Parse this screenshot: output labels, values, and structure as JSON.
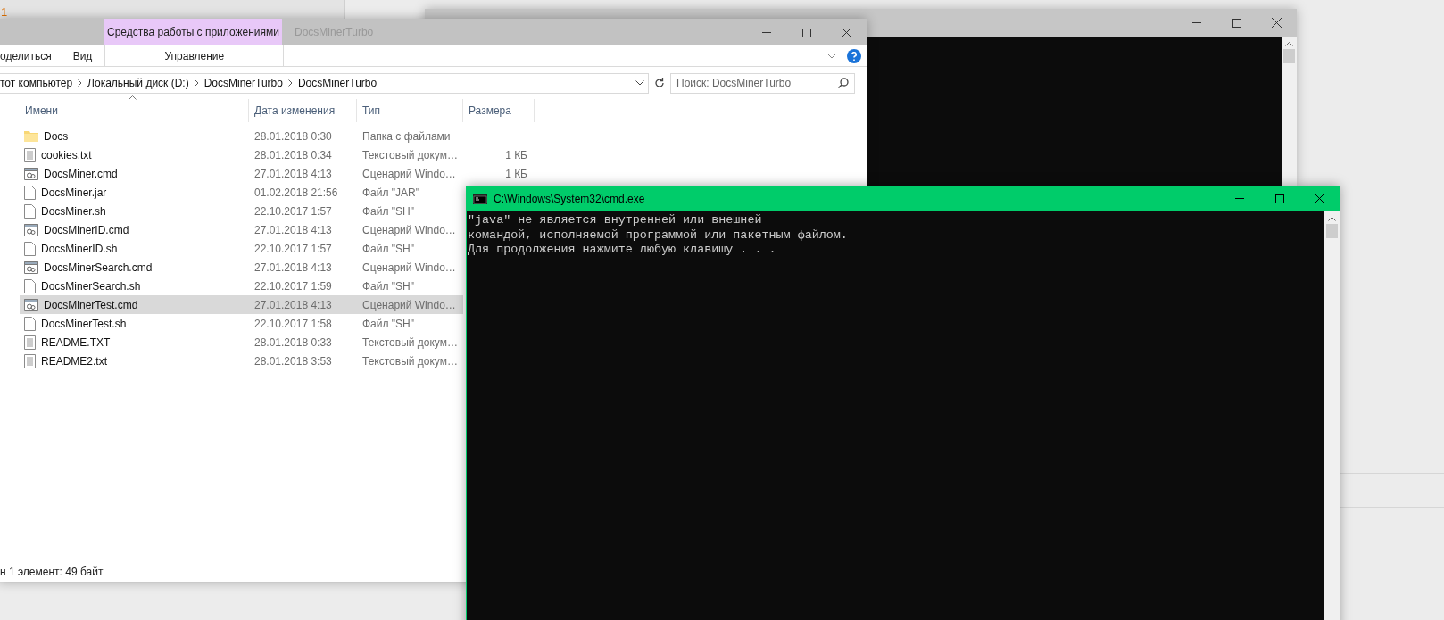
{
  "background_app": {
    "mark": "1"
  },
  "explorer": {
    "context_tab": "Средства работы с приложениями",
    "title": "DocsMinerTurbo",
    "ribbon_tabs": [
      {
        "label": "оделиться",
        "kind": "normal"
      },
      {
        "label": "Вид",
        "kind": "normal"
      },
      {
        "label": "Управление",
        "kind": "context"
      }
    ],
    "breadcrumbs": [
      "тот компьютер",
      "Локальный диск (D:)",
      "DocsMinerTurbo",
      "DocsMinerTurbo"
    ],
    "search": {
      "placeholder": "Поиск: DocsMinerTurbo"
    },
    "columns": [
      "Имени",
      "Дата изменения",
      "Тип",
      "Размера"
    ],
    "files": [
      {
        "name": "Docs",
        "date": "28.01.2018 0:30",
        "type": "Папка с файлами",
        "kind": "folder",
        "selected": false
      },
      {
        "name": "cookies.txt",
        "date": "28.01.2018 0:34",
        "type": "Текстовый докум…",
        "size": "1 КБ",
        "kind": "text",
        "selected": false
      },
      {
        "name": "DocsMiner.cmd",
        "date": "27.01.2018 4:13",
        "type": "Сценарий Windo…",
        "size": "1 КБ",
        "kind": "script",
        "selected": false
      },
      {
        "name": "DocsMiner.jar",
        "date": "01.02.2018 21:56",
        "type": "Файл \"JAR\"",
        "kind": "file",
        "selected": false
      },
      {
        "name": "DocsMiner.sh",
        "date": "22.10.2017 1:57",
        "type": "Файл \"SH\"",
        "kind": "file",
        "selected": false
      },
      {
        "name": "DocsMinerID.cmd",
        "date": "27.01.2018 4:13",
        "type": "Сценарий Windo…",
        "kind": "script",
        "selected": false
      },
      {
        "name": "DocsMinerID.sh",
        "date": "22.10.2017 1:57",
        "type": "Файл \"SH\"",
        "kind": "file",
        "selected": false
      },
      {
        "name": "DocsMinerSearch.cmd",
        "date": "27.01.2018 4:13",
        "type": "Сценарий Windo…",
        "kind": "script",
        "selected": false
      },
      {
        "name": "DocsMinerSearch.sh",
        "date": "22.10.2017 1:59",
        "type": "Файл \"SH\"",
        "kind": "file",
        "selected": false
      },
      {
        "name": "DocsMinerTest.cmd",
        "date": "27.01.2018 4:13",
        "type": "Сценарий Windo…",
        "kind": "script",
        "selected": true
      },
      {
        "name": "DocsMinerTest.sh",
        "date": "22.10.2017 1:58",
        "type": "Файл \"SH\"",
        "kind": "file",
        "selected": false
      },
      {
        "name": "README.TXT",
        "date": "28.01.2018 0:33",
        "type": "Текстовый докум…",
        "kind": "text",
        "selected": false
      },
      {
        "name": "README2.txt",
        "date": "28.01.2018 3:53",
        "type": "Текстовый докум…",
        "kind": "text",
        "selected": false
      }
    ],
    "status": "н 1 элемент: 49 байт"
  },
  "cmd": {
    "title": "C:\\Windows\\System32\\cmd.exe",
    "lines": [
      "\"java\" не является внутренней или внешней",
      "командой, исполняемой программой или пакетным файлом.",
      "Для продолжения нажмите любую клавишу . . ."
    ]
  }
}
